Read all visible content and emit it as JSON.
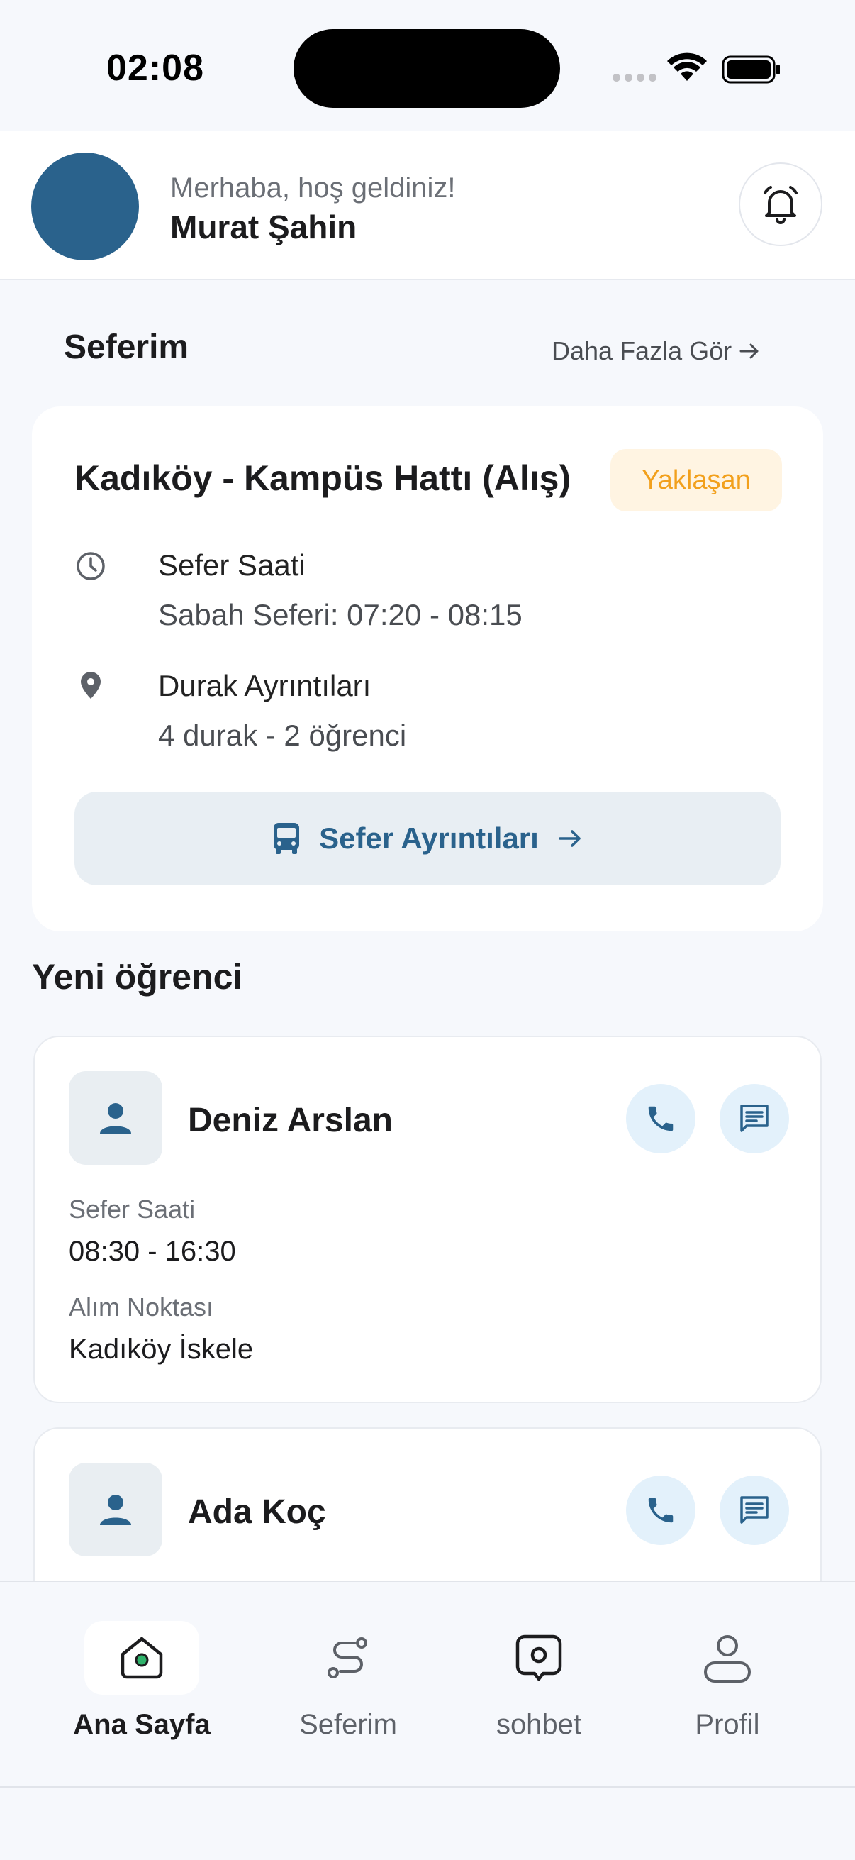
{
  "status_bar": {
    "time": "02:08"
  },
  "header": {
    "greeting": "Merhaba, hoş geldiniz!",
    "user_name": "Murat Şahin",
    "avatar_color": "#2a628c"
  },
  "trip_section": {
    "title": "Seferim",
    "see_more": "Daha Fazla Gör",
    "card": {
      "route_name": "Kadıköy - Kampüs Hattı (Alış)",
      "status": "Yaklaşan",
      "time_label": "Sefer Saati",
      "time_value": "Sabah Seferi: 07:20 - 08:15",
      "stops_label": "Durak Ayrıntıları",
      "stops_value": "4 durak - 2 öğrenci",
      "details_button": "Sefer Ayrıntıları"
    }
  },
  "new_students": {
    "title": "Yeni öğrenci",
    "students": [
      {
        "name": "Deniz Arslan",
        "time_label": "Sefer Saati",
        "time_value": "08:30 - 16:30",
        "pickup_label": "Alım Noktası",
        "pickup_value": "Kadıköy İskele"
      },
      {
        "name": "Ada Koç"
      }
    ]
  },
  "bottom_nav": {
    "items": [
      {
        "label": "Ana Sayfa",
        "icon": "home-icon",
        "active": true
      },
      {
        "label": "Seferim",
        "icon": "route-icon",
        "active": false
      },
      {
        "label": "sohbet",
        "icon": "chat-icon",
        "active": false
      },
      {
        "label": "Profil",
        "icon": "profile-icon",
        "active": false
      }
    ]
  },
  "colors": {
    "primary": "#2a628c",
    "badge_bg": "#fff4e2",
    "badge_text": "#f2a01c",
    "background": "#f6f8fc"
  }
}
